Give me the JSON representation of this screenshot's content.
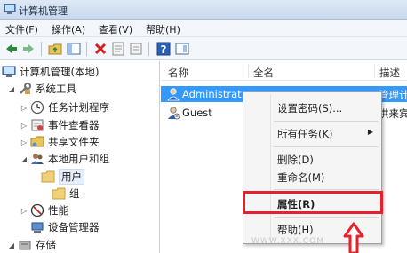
{
  "window": {
    "title": "计算机管理",
    "icon": "computer-management-icon"
  },
  "menubar": [
    {
      "label": "文件(F)"
    },
    {
      "label": "操作(A)"
    },
    {
      "label": "查看(V)"
    },
    {
      "label": "帮助(H)"
    }
  ],
  "toolbar": {
    "icons": [
      "back-icon",
      "forward-icon",
      "up-folder-icon",
      "show-tree-icon",
      "delete-icon",
      "properties-icon",
      "export-icon",
      "help-icon",
      "view-icon"
    ]
  },
  "tree": {
    "items": [
      {
        "label": "计算机管理(本地)",
        "icon": "computer-icon"
      },
      {
        "label": "系统工具",
        "icon": "tools-icon"
      },
      {
        "label": "任务计划程序",
        "icon": "clock-icon"
      },
      {
        "label": "事件查看器",
        "icon": "event-viewer-icon"
      },
      {
        "label": "共享文件夹",
        "icon": "shared-folder-icon"
      },
      {
        "label": "本地用户和组",
        "icon": "users-icon"
      },
      {
        "label": "用户",
        "icon": "folder-icon"
      },
      {
        "label": "组",
        "icon": "folder-icon"
      },
      {
        "label": "性能",
        "icon": "performance-icon"
      },
      {
        "label": "设备管理器",
        "icon": "device-manager-icon"
      },
      {
        "label": "存储",
        "icon": "storage-icon"
      }
    ]
  },
  "list": {
    "columns": {
      "name": "名称",
      "fullname": "全名",
      "description": "描述"
    },
    "rows": [
      {
        "name": "Administrat...",
        "description": "管理计"
      },
      {
        "name": "Guest",
        "description": "供来宾"
      }
    ]
  },
  "context_menu": {
    "items": [
      {
        "label": "设置密码(S)..."
      },
      {
        "label": "所有任务(K)"
      },
      {
        "label": "删除(D)"
      },
      {
        "label": "重命名(M)"
      },
      {
        "label": "属性(R)"
      },
      {
        "label": "帮助(H)"
      }
    ]
  },
  "colors": {
    "selection": "#3399ff",
    "highlight": "#e8202a"
  },
  "watermark": "WWW.XXX.COM"
}
